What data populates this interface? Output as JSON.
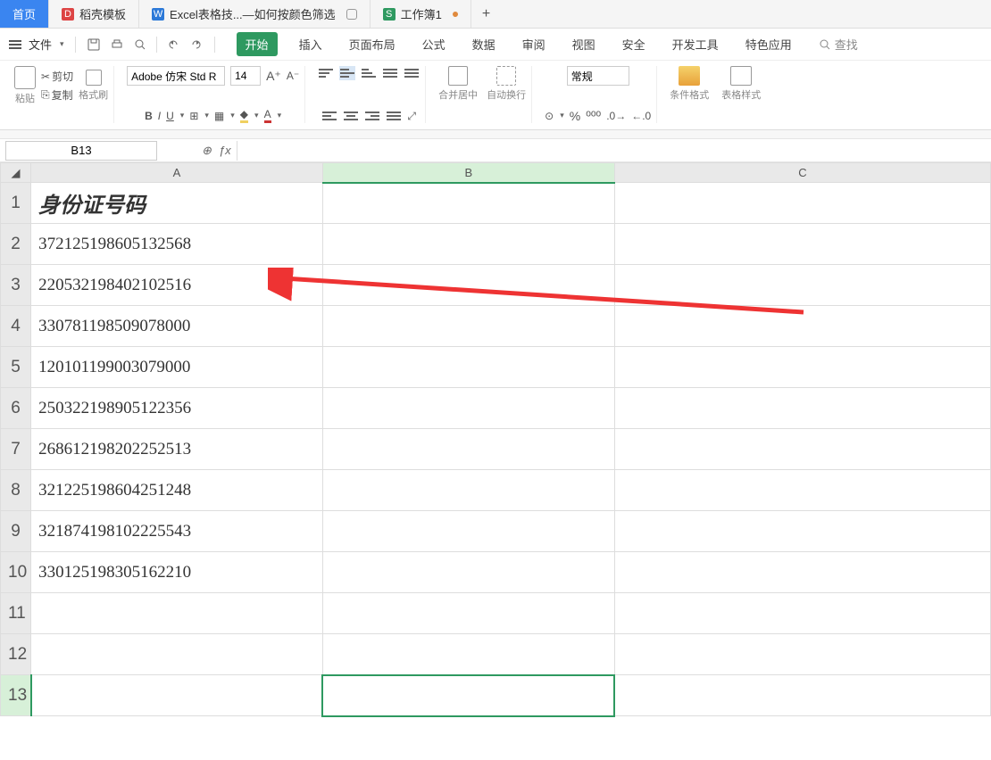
{
  "tabs": {
    "home": "首页",
    "t1": "稻壳模板",
    "t2": "Excel表格技...—如何按颜色筛选",
    "t3": "工作簿1"
  },
  "file_menu": "文件",
  "menu": {
    "start": "开始",
    "insert": "插入",
    "layout": "页面布局",
    "formula": "公式",
    "data": "数据",
    "review": "审阅",
    "view": "视图",
    "security": "安全",
    "dev": "开发工具",
    "special": "特色应用"
  },
  "search": "查找",
  "ribbon": {
    "paste": "粘贴",
    "cut": "剪切",
    "copy": "复制",
    "format_painter": "格式刷",
    "font_name": "Adobe 仿宋 Std R",
    "font_size": "14",
    "merge": "合并居中",
    "wrap": "自动换行",
    "general": "常规",
    "cond": "条件格式",
    "fmhlp": "表格样式"
  },
  "namebox": "B13",
  "columns": [
    "A",
    "B",
    "C"
  ],
  "row_nums": [
    "1",
    "2",
    "3",
    "4",
    "5",
    "6",
    "7",
    "8",
    "9",
    "10",
    "11",
    "12",
    "13"
  ],
  "cells": {
    "A1": "身份证号码",
    "A2": "372125198605132568",
    "A3": "220532198402102516",
    "A4": "330781198509078000",
    "A5": "120101199003079000",
    "A6": "250322198905122356",
    "A7": "268612198202252513",
    "A8": "321225198604251248",
    "A9": "321874198102225543",
    "A10": "330125198305162210"
  },
  "chart_data": {
    "type": "table",
    "title": "身份证号码",
    "columns": [
      "A"
    ],
    "rows": [
      [
        "372125198605132568"
      ],
      [
        "220532198402102516"
      ],
      [
        "330781198509078000"
      ],
      [
        "120101199003079000"
      ],
      [
        "250322198905122356"
      ],
      [
        "268612198202252513"
      ],
      [
        "321225198604251248"
      ],
      [
        "321874198102225543"
      ],
      [
        "330125198305162210"
      ]
    ]
  }
}
